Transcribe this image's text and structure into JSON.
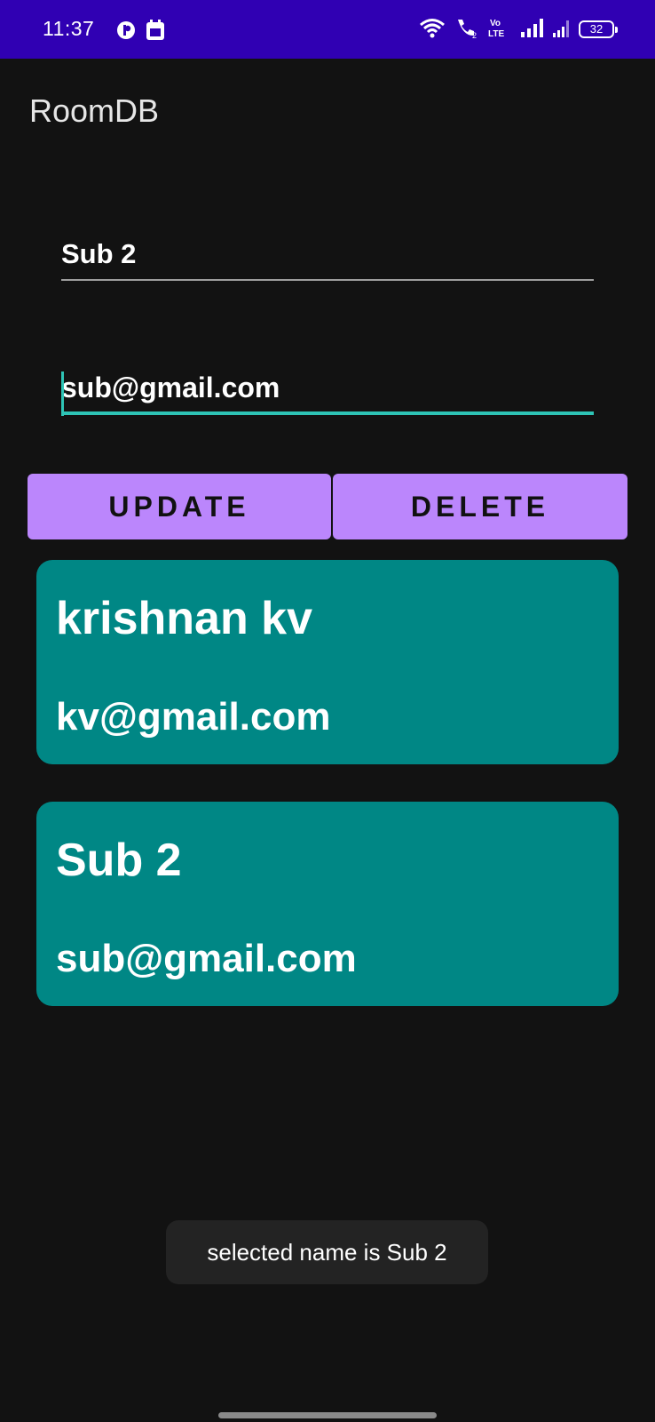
{
  "status_bar": {
    "time": "11:37",
    "battery": "32"
  },
  "app_bar": {
    "title": "RoomDB"
  },
  "form": {
    "name_value": "Sub 2",
    "email_value": "sub@gmail.com"
  },
  "buttons": {
    "update_label": "UPDATE",
    "delete_label": "DELETE"
  },
  "users": [
    {
      "name": "krishnan kv",
      "email": "kv@gmail.com"
    },
    {
      "name": "Sub 2",
      "email": "sub@gmail.com"
    }
  ],
  "toast": {
    "message": "selected name is Sub 2"
  },
  "colors": {
    "status_bar": "#3000b3",
    "background": "#121212",
    "button": "#bb86fc",
    "card": "#008785",
    "accent": "#2ec4b6"
  }
}
